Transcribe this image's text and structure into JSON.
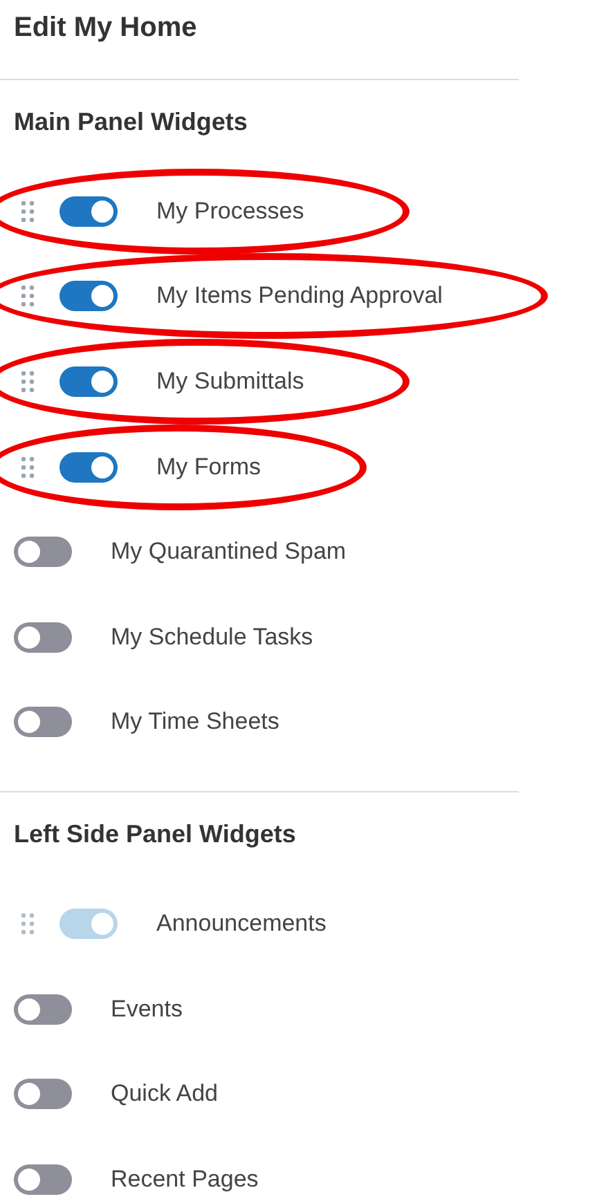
{
  "title": "Edit My Home",
  "sections": [
    {
      "heading": "Main Panel Widgets",
      "items": [
        {
          "label": "My Processes",
          "on": true,
          "disabled": false,
          "highlighted": true
        },
        {
          "label": "My Items Pending Approval",
          "on": true,
          "disabled": false,
          "highlighted": true
        },
        {
          "label": "My Submittals",
          "on": true,
          "disabled": false,
          "highlighted": true
        },
        {
          "label": "My Forms",
          "on": true,
          "disabled": false,
          "highlighted": true
        },
        {
          "label": "My Quarantined Spam",
          "on": false,
          "disabled": false,
          "highlighted": false
        },
        {
          "label": "My Schedule Tasks",
          "on": false,
          "disabled": false,
          "highlighted": false
        },
        {
          "label": "My Time Sheets",
          "on": false,
          "disabled": false,
          "highlighted": false
        }
      ]
    },
    {
      "heading": "Left Side Panel Widgets",
      "items": [
        {
          "label": "Announcements",
          "on": true,
          "disabled": true,
          "highlighted": false
        },
        {
          "label": "Events",
          "on": false,
          "disabled": false,
          "highlighted": false
        },
        {
          "label": "Quick Add",
          "on": false,
          "disabled": false,
          "highlighted": false
        },
        {
          "label": "Recent Pages",
          "on": false,
          "disabled": false,
          "highlighted": false
        }
      ]
    }
  ]
}
